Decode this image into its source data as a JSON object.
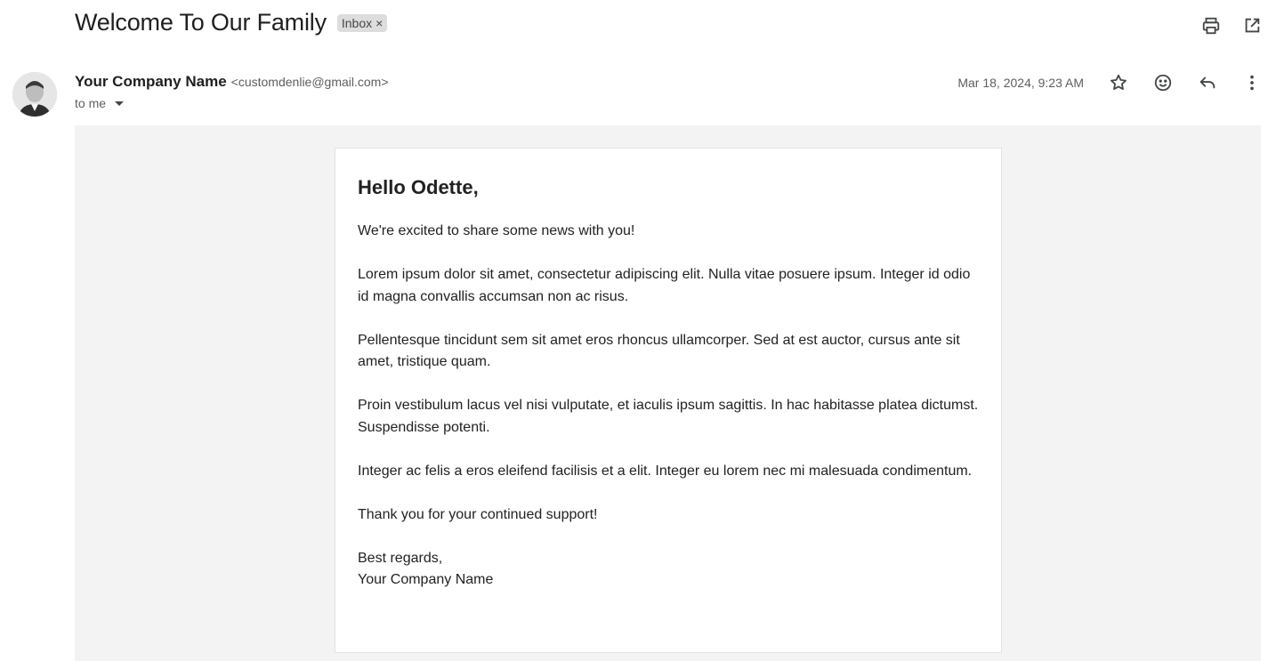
{
  "email": {
    "subject": "Welcome To Our Family",
    "label": "Inbox",
    "label_remove": "×",
    "sender_name": "Your Company Name",
    "sender_email": "<customdenlie@gmail.com>",
    "recipient": "to me",
    "timestamp": "Mar 18, 2024, 9:23 AM"
  },
  "icons": {
    "print": "print-icon",
    "open_new_window": "open-in-new-icon",
    "star": "star-icon",
    "emoji": "emoji-icon",
    "reply": "reply-icon",
    "more": "more-vertical-icon"
  },
  "body": {
    "greeting": "Hello Odette,",
    "paragraphs": [
      "We're excited to share some news with you!",
      "Lorem ipsum dolor sit amet, consectetur adipiscing elit. Nulla vitae posuere ipsum. Integer id odio id magna convallis accumsan non ac risus.",
      "Pellentesque tincidunt sem sit amet eros rhoncus ullamcorper. Sed at est auctor, cursus ante sit amet, tristique quam.",
      "Proin vestibulum lacus vel nisi vulputate, et iaculis ipsum sagittis. In hac habitasse platea dictumst. Suspendisse potenti.",
      "Integer ac felis a eros eleifend facilisis et a elit. Integer eu lorem nec mi malesuada condimentum.",
      "Thank you for your continued support!"
    ],
    "closing": "Best regards,",
    "signature": "Your Company Name"
  }
}
